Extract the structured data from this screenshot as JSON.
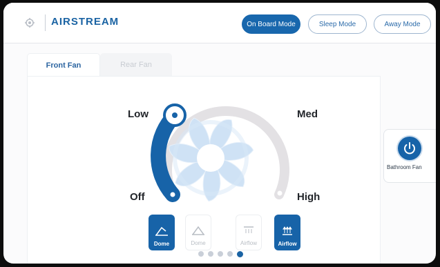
{
  "header": {
    "brand": "AIRSTREAM",
    "modes": [
      {
        "label": "On Board Mode",
        "active": true
      },
      {
        "label": "Sleep Mode",
        "active": false
      },
      {
        "label": "Away Mode",
        "active": false
      }
    ]
  },
  "tabs": [
    {
      "label": "Front Fan",
      "active": true
    },
    {
      "label": "Rear Fan",
      "active": false
    }
  ],
  "fan_control": {
    "current_speed": "Low",
    "speed_labels": {
      "low": "Low",
      "med": "Med",
      "off": "Off",
      "high": "High"
    }
  },
  "mode_buttons": [
    {
      "label": "Dome",
      "selected": true,
      "icon": "dome-open-icon"
    },
    {
      "label": "Dome",
      "selected": false,
      "icon": "dome-closed-icon"
    },
    {
      "label": "Airflow",
      "selected": false,
      "icon": "airflow-down-icon"
    },
    {
      "label": "Airflow",
      "selected": true,
      "icon": "airflow-up-icon"
    }
  ],
  "pagination": {
    "total": 5,
    "current_index": 4
  },
  "side_panel": {
    "label": "Bathroom Fan",
    "icon": "power-icon"
  },
  "colors": {
    "primary": "#1763a8",
    "track": "#e3e1e4",
    "blade": "#cfe2f5"
  }
}
